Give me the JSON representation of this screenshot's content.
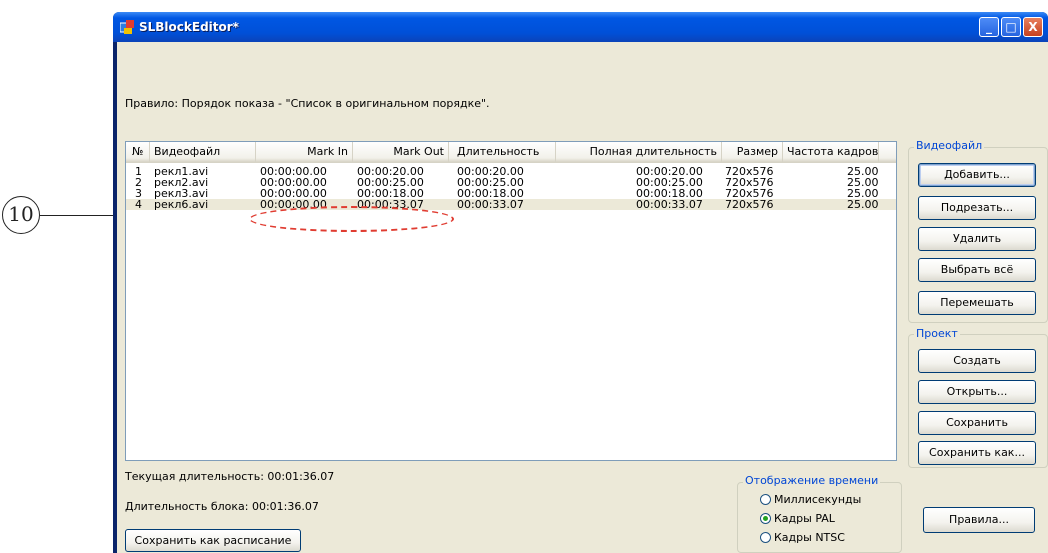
{
  "window": {
    "title": "SLBlockEditor*",
    "controls": [
      "_",
      "□",
      "X"
    ]
  },
  "rule_text": "Правило: Порядок показа - \"Список в оригинальном порядке\".",
  "table": {
    "columns": [
      "№",
      "Видеофайл",
      "Mark In",
      "Mark Out",
      "Длительность",
      "Полная длительность",
      "Размер",
      "Частота кадров"
    ],
    "rows": [
      [
        "1",
        "рекл1.avi",
        "00:00:00.00",
        "00:00:20.00",
        "00:00:20.00",
        "00:00:20.00",
        "720x576",
        "25.00"
      ],
      [
        "2",
        "рекл2.avi",
        "00:00:00.00",
        "00:00:25.00",
        "00:00:25.00",
        "00:00:25.00",
        "720x576",
        "25.00"
      ],
      [
        "3",
        "рекл3.avi",
        "00:00:00.00",
        "00:00:18.00",
        "00:00:18.00",
        "00:00:18.00",
        "720x576",
        "25.00"
      ],
      [
        "4",
        "рекл6.avi",
        "00:00:00.00",
        "00:00:33.07",
        "00:00:33.07",
        "00:00:33.07",
        "720x576",
        "25.00"
      ]
    ],
    "selected_row": 3
  },
  "status": {
    "current_duration": "Текущая длительность: 00:01:36.07",
    "block_duration": "Длительность блока: 00:01:36.07"
  },
  "save_schedule_button": "Сохранить как расписание",
  "videofile_group": {
    "label": "Видеофайл",
    "buttons": [
      "Добавить...",
      "Подрезать...",
      "Удалить",
      "Выбрать всё",
      "Перемешать"
    ]
  },
  "project_group": {
    "label": "Проект",
    "buttons": [
      "Создать",
      "Открыть...",
      "Сохранить",
      "Сохранить как..."
    ]
  },
  "time_display": {
    "label": "Отображение времени",
    "options": [
      "Миллисекунды",
      "Кадры PAL",
      "Кадры NTSC"
    ],
    "selected": 1
  },
  "rules_button": "Правила...",
  "callout_label": "10",
  "colors": {
    "title_bar": "#0054e3",
    "client": "#ece9d8",
    "group_label": "#0046d5",
    "callout_oval": "#e03c31"
  }
}
